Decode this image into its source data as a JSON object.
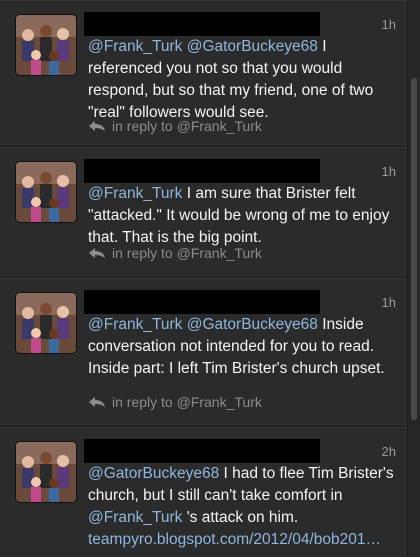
{
  "tweets": [
    {
      "time": "1h",
      "body_before": "",
      "m1": "@Frank_Turk",
      "m2": "@GatorBuckeye68",
      "text": " I referenced you not so that you would respond, but so that my friend, one of two \"real\" followers would see.",
      "reply": "in reply to @Frank_Turk"
    },
    {
      "time": "1h",
      "m1": "@Frank_Turk",
      "text": " I am sure that Brister felt \"attacked.\" It would be wrong of me to enjoy that. That is the big point.",
      "reply": "in reply to @Frank_Turk"
    },
    {
      "time": "1h",
      "m1": "@Frank_Turk",
      "m2": "@GatorBuckeye68",
      "text": " Inside conversation not intended for you to read. Inside part: I left Tim Brister's church upset.",
      "reply": "in reply to @Frank_Turk"
    },
    {
      "time": "2h",
      "m1": "@GatorBuckeye68",
      "text1": " I had to flee Tim Brister's church, but I still can't take comfort in ",
      "m2": "@Frank_Turk",
      "text2": " 's attack on him. ",
      "link": "teampyro.blogspot.com/2012/04/bob201…"
    }
  ],
  "icons": {
    "avatar": "avatar-photo",
    "reply": "reply-arrow-icon"
  },
  "colors": {
    "mention": "#8fb6df",
    "background": "#2b2b2b"
  }
}
